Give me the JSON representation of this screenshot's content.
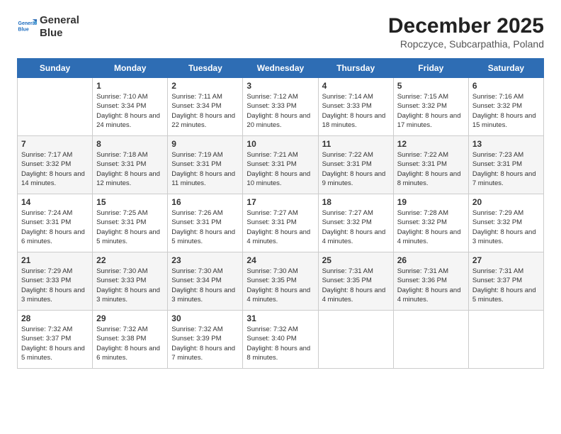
{
  "logo": {
    "line1": "General",
    "line2": "Blue"
  },
  "title": "December 2025",
  "subtitle": "Ropczyce, Subcarpathia, Poland",
  "headers": [
    "Sunday",
    "Monday",
    "Tuesday",
    "Wednesday",
    "Thursday",
    "Friday",
    "Saturday"
  ],
  "weeks": [
    [
      {
        "day": "",
        "sunrise": "",
        "sunset": "",
        "daylight": ""
      },
      {
        "day": "1",
        "sunrise": "Sunrise: 7:10 AM",
        "sunset": "Sunset: 3:34 PM",
        "daylight": "Daylight: 8 hours and 24 minutes."
      },
      {
        "day": "2",
        "sunrise": "Sunrise: 7:11 AM",
        "sunset": "Sunset: 3:34 PM",
        "daylight": "Daylight: 8 hours and 22 minutes."
      },
      {
        "day": "3",
        "sunrise": "Sunrise: 7:12 AM",
        "sunset": "Sunset: 3:33 PM",
        "daylight": "Daylight: 8 hours and 20 minutes."
      },
      {
        "day": "4",
        "sunrise": "Sunrise: 7:14 AM",
        "sunset": "Sunset: 3:33 PM",
        "daylight": "Daylight: 8 hours and 18 minutes."
      },
      {
        "day": "5",
        "sunrise": "Sunrise: 7:15 AM",
        "sunset": "Sunset: 3:32 PM",
        "daylight": "Daylight: 8 hours and 17 minutes."
      },
      {
        "day": "6",
        "sunrise": "Sunrise: 7:16 AM",
        "sunset": "Sunset: 3:32 PM",
        "daylight": "Daylight: 8 hours and 15 minutes."
      }
    ],
    [
      {
        "day": "7",
        "sunrise": "Sunrise: 7:17 AM",
        "sunset": "Sunset: 3:32 PM",
        "daylight": "Daylight: 8 hours and 14 minutes."
      },
      {
        "day": "8",
        "sunrise": "Sunrise: 7:18 AM",
        "sunset": "Sunset: 3:31 PM",
        "daylight": "Daylight: 8 hours and 12 minutes."
      },
      {
        "day": "9",
        "sunrise": "Sunrise: 7:19 AM",
        "sunset": "Sunset: 3:31 PM",
        "daylight": "Daylight: 8 hours and 11 minutes."
      },
      {
        "day": "10",
        "sunrise": "Sunrise: 7:21 AM",
        "sunset": "Sunset: 3:31 PM",
        "daylight": "Daylight: 8 hours and 10 minutes."
      },
      {
        "day": "11",
        "sunrise": "Sunrise: 7:22 AM",
        "sunset": "Sunset: 3:31 PM",
        "daylight": "Daylight: 8 hours and 9 minutes."
      },
      {
        "day": "12",
        "sunrise": "Sunrise: 7:22 AM",
        "sunset": "Sunset: 3:31 PM",
        "daylight": "Daylight: 8 hours and 8 minutes."
      },
      {
        "day": "13",
        "sunrise": "Sunrise: 7:23 AM",
        "sunset": "Sunset: 3:31 PM",
        "daylight": "Daylight: 8 hours and 7 minutes."
      }
    ],
    [
      {
        "day": "14",
        "sunrise": "Sunrise: 7:24 AM",
        "sunset": "Sunset: 3:31 PM",
        "daylight": "Daylight: 8 hours and 6 minutes."
      },
      {
        "day": "15",
        "sunrise": "Sunrise: 7:25 AM",
        "sunset": "Sunset: 3:31 PM",
        "daylight": "Daylight: 8 hours and 5 minutes."
      },
      {
        "day": "16",
        "sunrise": "Sunrise: 7:26 AM",
        "sunset": "Sunset: 3:31 PM",
        "daylight": "Daylight: 8 hours and 5 minutes."
      },
      {
        "day": "17",
        "sunrise": "Sunrise: 7:27 AM",
        "sunset": "Sunset: 3:31 PM",
        "daylight": "Daylight: 8 hours and 4 minutes."
      },
      {
        "day": "18",
        "sunrise": "Sunrise: 7:27 AM",
        "sunset": "Sunset: 3:32 PM",
        "daylight": "Daylight: 8 hours and 4 minutes."
      },
      {
        "day": "19",
        "sunrise": "Sunrise: 7:28 AM",
        "sunset": "Sunset: 3:32 PM",
        "daylight": "Daylight: 8 hours and 4 minutes."
      },
      {
        "day": "20",
        "sunrise": "Sunrise: 7:29 AM",
        "sunset": "Sunset: 3:32 PM",
        "daylight": "Daylight: 8 hours and 3 minutes."
      }
    ],
    [
      {
        "day": "21",
        "sunrise": "Sunrise: 7:29 AM",
        "sunset": "Sunset: 3:33 PM",
        "daylight": "Daylight: 8 hours and 3 minutes."
      },
      {
        "day": "22",
        "sunrise": "Sunrise: 7:30 AM",
        "sunset": "Sunset: 3:33 PM",
        "daylight": "Daylight: 8 hours and 3 minutes."
      },
      {
        "day": "23",
        "sunrise": "Sunrise: 7:30 AM",
        "sunset": "Sunset: 3:34 PM",
        "daylight": "Daylight: 8 hours and 3 minutes."
      },
      {
        "day": "24",
        "sunrise": "Sunrise: 7:30 AM",
        "sunset": "Sunset: 3:35 PM",
        "daylight": "Daylight: 8 hours and 4 minutes."
      },
      {
        "day": "25",
        "sunrise": "Sunrise: 7:31 AM",
        "sunset": "Sunset: 3:35 PM",
        "daylight": "Daylight: 8 hours and 4 minutes."
      },
      {
        "day": "26",
        "sunrise": "Sunrise: 7:31 AM",
        "sunset": "Sunset: 3:36 PM",
        "daylight": "Daylight: 8 hours and 4 minutes."
      },
      {
        "day": "27",
        "sunrise": "Sunrise: 7:31 AM",
        "sunset": "Sunset: 3:37 PM",
        "daylight": "Daylight: 8 hours and 5 minutes."
      }
    ],
    [
      {
        "day": "28",
        "sunrise": "Sunrise: 7:32 AM",
        "sunset": "Sunset: 3:37 PM",
        "daylight": "Daylight: 8 hours and 5 minutes."
      },
      {
        "day": "29",
        "sunrise": "Sunrise: 7:32 AM",
        "sunset": "Sunset: 3:38 PM",
        "daylight": "Daylight: 8 hours and 6 minutes."
      },
      {
        "day": "30",
        "sunrise": "Sunrise: 7:32 AM",
        "sunset": "Sunset: 3:39 PM",
        "daylight": "Daylight: 8 hours and 7 minutes."
      },
      {
        "day": "31",
        "sunrise": "Sunrise: 7:32 AM",
        "sunset": "Sunset: 3:40 PM",
        "daylight": "Daylight: 8 hours and 8 minutes."
      },
      {
        "day": "",
        "sunrise": "",
        "sunset": "",
        "daylight": ""
      },
      {
        "day": "",
        "sunrise": "",
        "sunset": "",
        "daylight": ""
      },
      {
        "day": "",
        "sunrise": "",
        "sunset": "",
        "daylight": ""
      }
    ]
  ]
}
